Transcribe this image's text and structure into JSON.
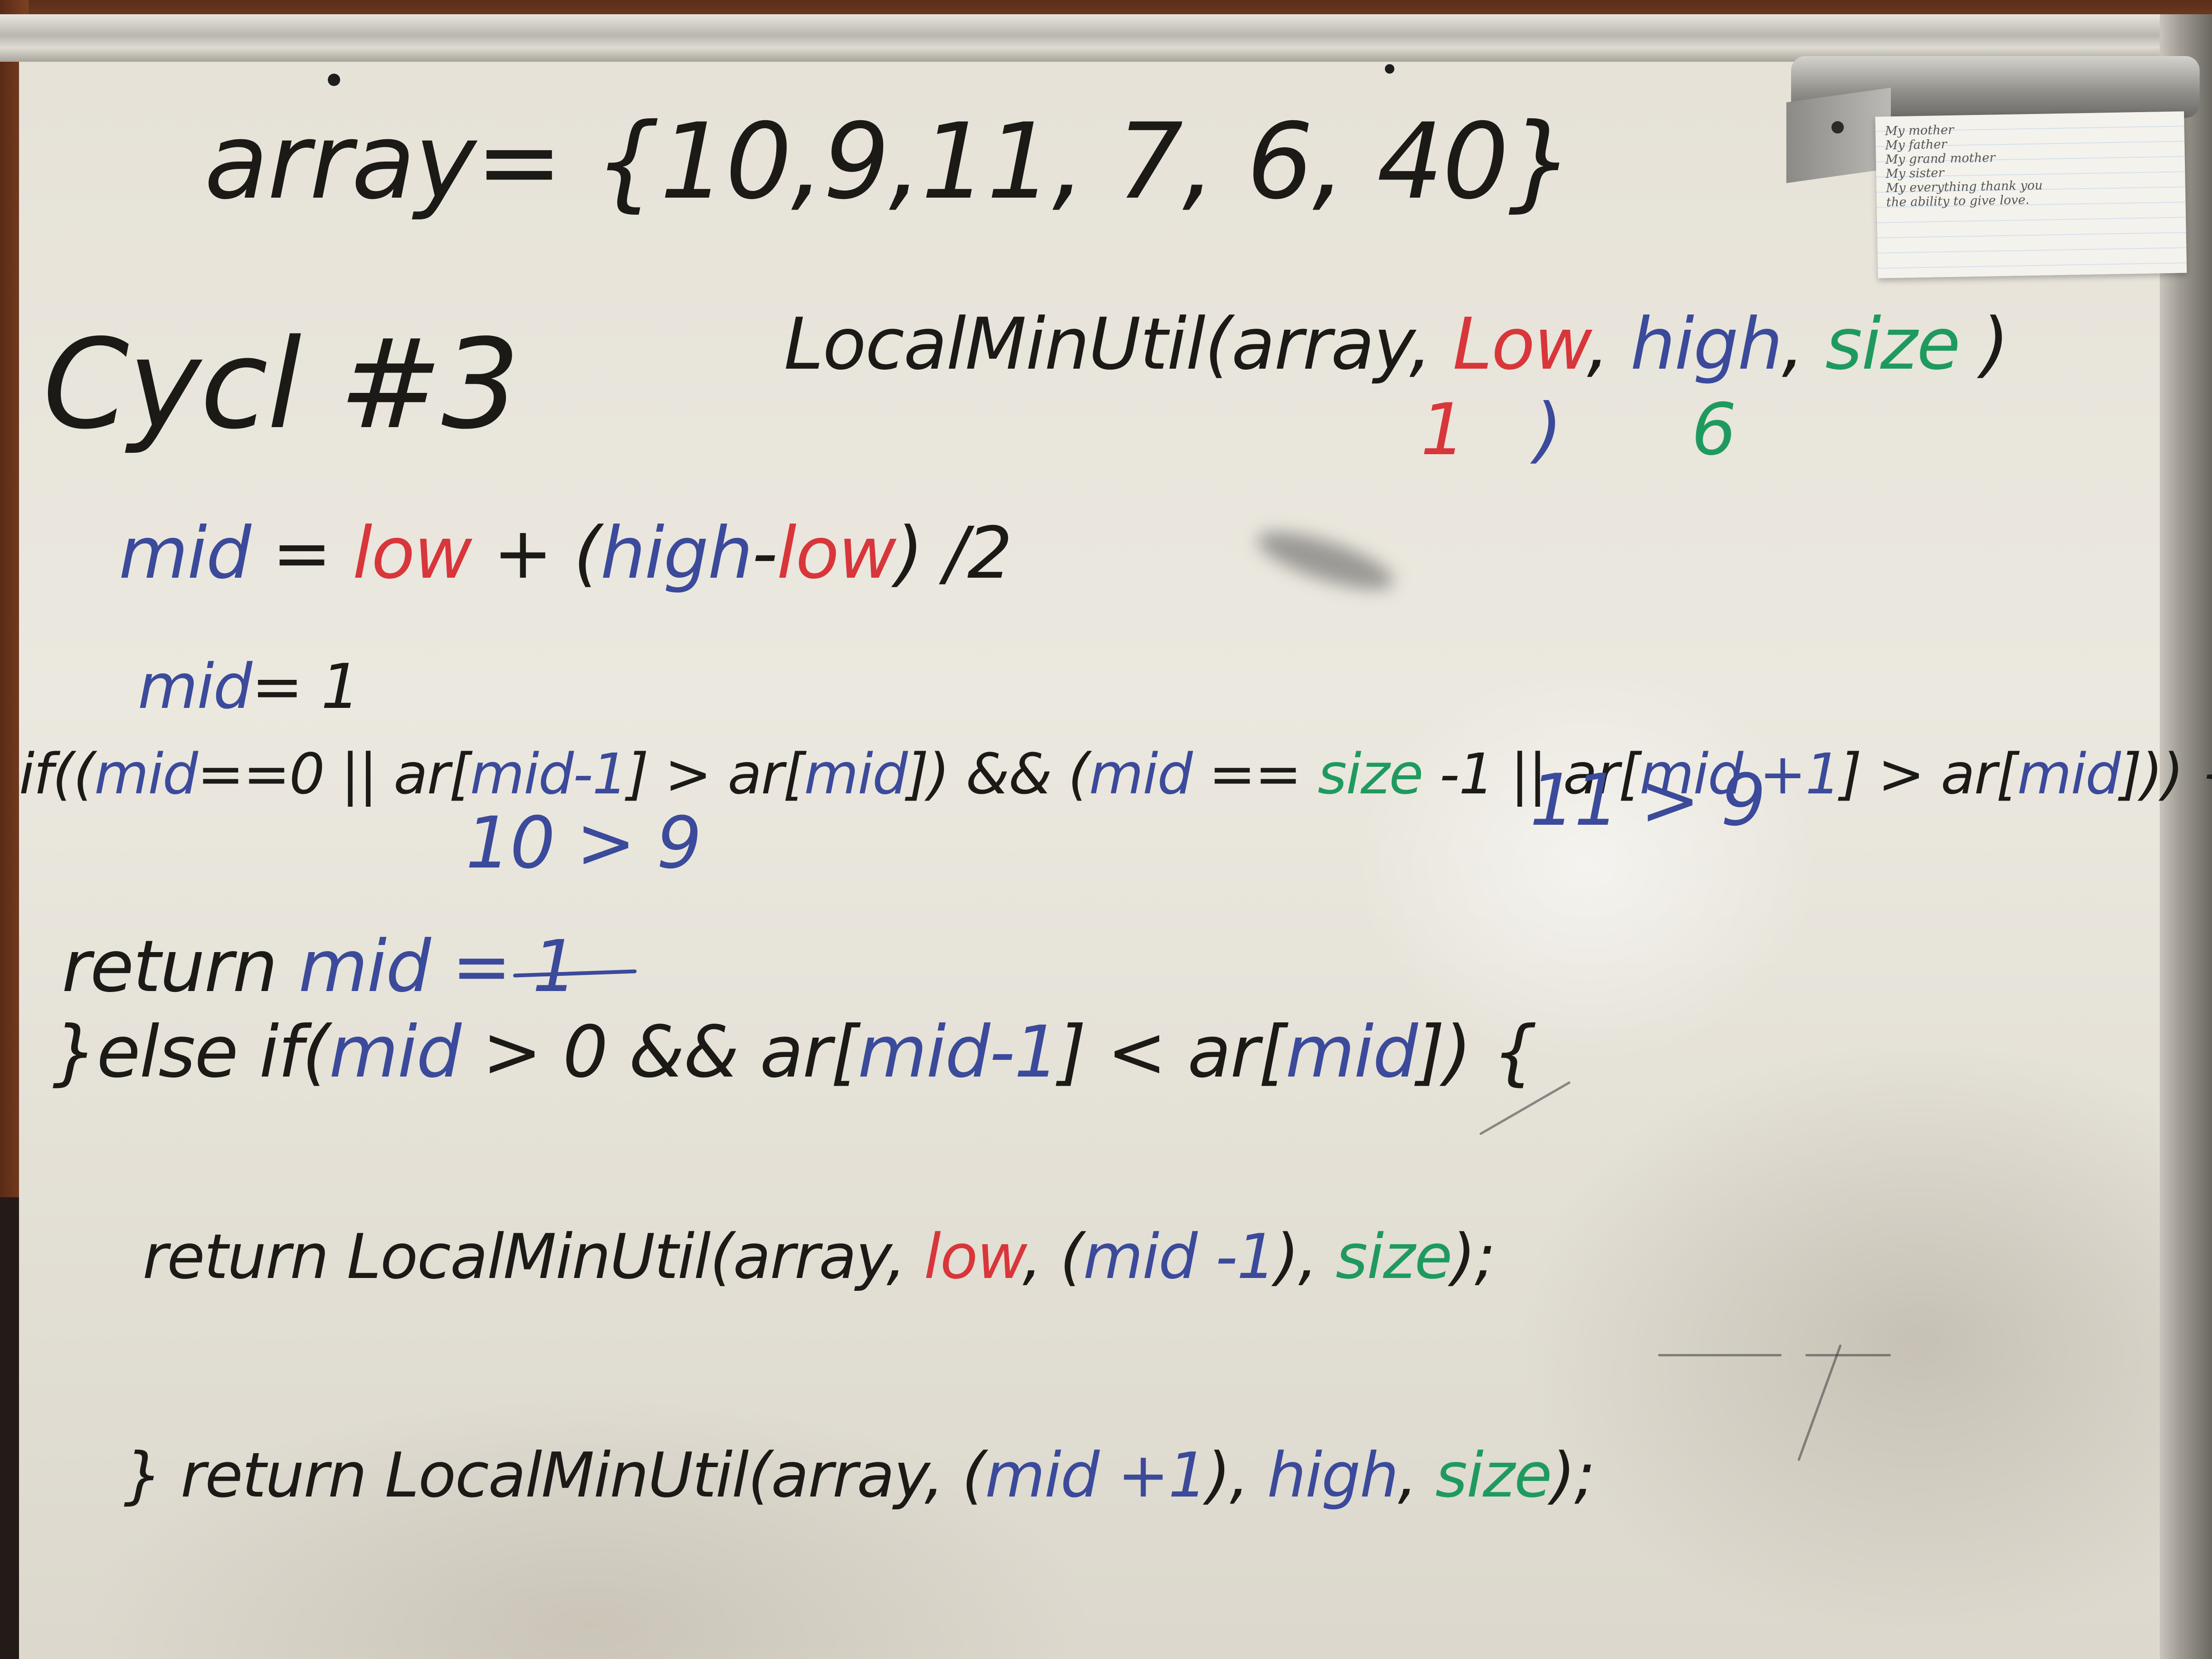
{
  "note_card": {
    "lines": [
      "My mother",
      "My father",
      "My grand mother",
      "My sister",
      "My everything thank you",
      "the ability to give love."
    ]
  },
  "whiteboard": {
    "array_line": "array= {10,9,11, 7, 6, 40}",
    "cycle_label": "Cycl #3",
    "call": {
      "prefix": "LocalMinUtil(array, ",
      "low": "Low",
      "comma1": ", ",
      "high": "high",
      "comma2": ", ",
      "size": "size",
      "suffix": " )"
    },
    "param_values": {
      "low": "1",
      "high": ")",
      "size": "6"
    },
    "mid_formula": {
      "mid": "mid",
      "eq": " = ",
      "low": "low",
      "plus": " + (",
      "high": "high",
      "minus": "-",
      "low2": "low",
      "tail": ") /2"
    },
    "mid_value": {
      "mid": "mid",
      "rest": "= 1"
    },
    "if_line": {
      "p1": "if((",
      "mid1": "mid",
      "p2": "==0 || ar[",
      "mid2": "mid-1",
      "p3": "] > ar[",
      "mid3": "mid",
      "p4": "]) && (",
      "mid4": "mid",
      "p5": " == ",
      "size": "size",
      "p6": " -1 || ar[",
      "mid5": "mid +1",
      "p7": "] > ar[",
      "mid6": "mid",
      "p8": "])) {"
    },
    "compare_left": "10 > 9",
    "compare_right": "11 > 9",
    "return_mid": {
      "ret": "return ",
      "mid": "mid",
      "rest": " = 1"
    },
    "else_if": {
      "p1": "}else if(",
      "mid1": "mid",
      "p2": " > 0 && ar[",
      "mid2": "mid-1",
      "p3": "] < ar[",
      "mid3": "mid",
      "p4": "]) {"
    },
    "return_left": {
      "p1": "return LocalMinUtil(array, ",
      "low": "low",
      "p2": ", (",
      "mid": "mid -1",
      "p3": "), ",
      "size": "size",
      "p4": ");"
    },
    "return_right": {
      "p1": "} return LocalMinUtil(array, (",
      "mid": "mid +1",
      "p2": "), ",
      "high": "high",
      "p3": ", ",
      "size": "size",
      "p4": ");"
    }
  }
}
